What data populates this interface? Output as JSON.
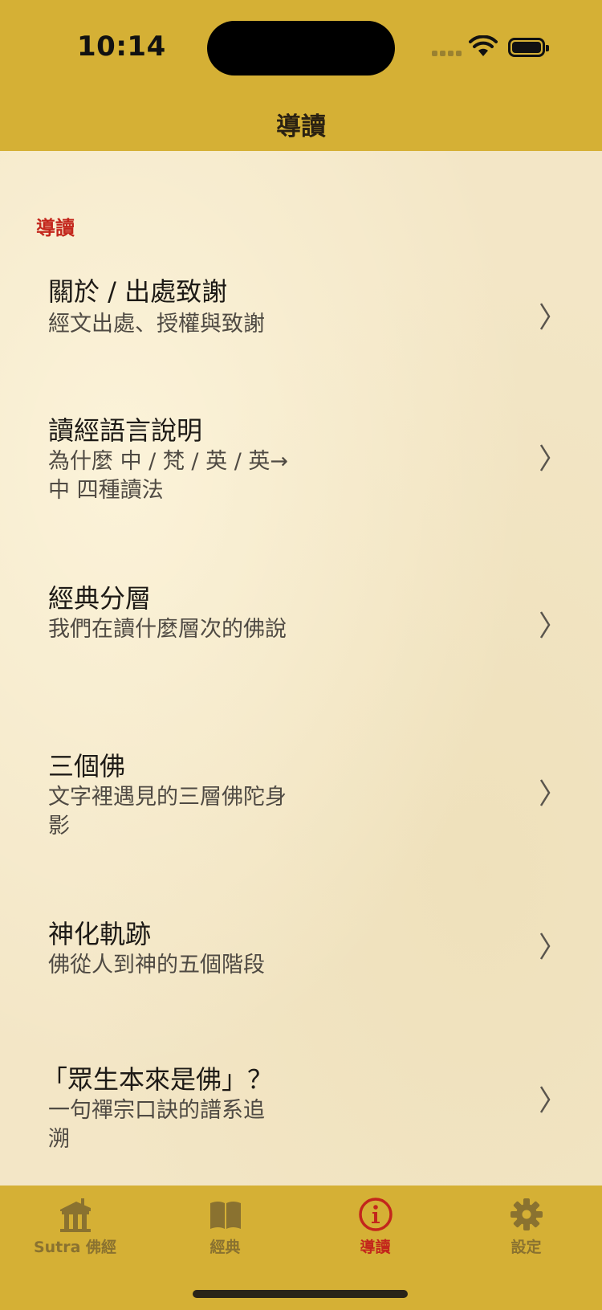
{
  "status": {
    "time": "10:14"
  },
  "nav": {
    "title": "導讀"
  },
  "section": {
    "header": "導讀"
  },
  "rows": [
    {
      "title": "關於 / 出處致謝",
      "subtitle": "經文出處、授權與致謝"
    },
    {
      "title": "讀經語言說明",
      "subtitle": "為什麼 中 / 梵 / 英 / 英→中 四種讀法"
    },
    {
      "title": "經典分層",
      "subtitle": "我們在讀什麼層次的佛說"
    },
    {
      "title": "三個佛",
      "subtitle": "文字裡遇見的三層佛陀身影"
    },
    {
      "title": "神化軌跡",
      "subtitle": "佛從人到神的五個階段"
    },
    {
      "title": "「眾生本來是佛」？",
      "subtitle": "一句禪宗口訣的譜系追溯"
    }
  ],
  "tabs": [
    {
      "label": "Sutra 佛經",
      "icon": "temple-icon",
      "active": false
    },
    {
      "label": "經典",
      "icon": "book-icon",
      "active": false
    },
    {
      "label": "導讀",
      "icon": "info-icon",
      "active": true
    },
    {
      "label": "設定",
      "icon": "gear-icon",
      "active": false
    }
  ],
  "colors": {
    "bar": "#d5b035",
    "paper": "#f3e6c6",
    "accent": "#c3261c",
    "inactive": "#8a7230"
  }
}
